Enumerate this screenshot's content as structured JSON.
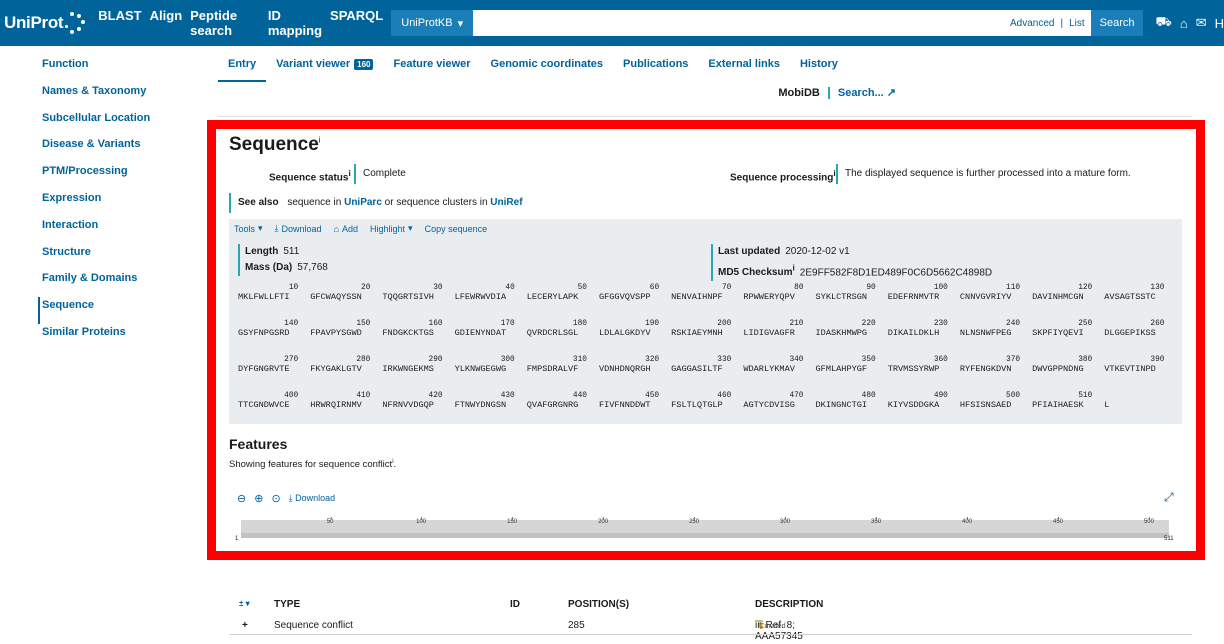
{
  "header": {
    "logo": "UniProt",
    "nav": [
      "BLAST",
      "Align",
      "Peptide search",
      "ID mapping",
      "SPARQL"
    ],
    "db_select": "UniProtKB",
    "search_placeholder": "",
    "advanced": "Advanced",
    "list": "List",
    "search_button": "Search",
    "truncated_label": "H"
  },
  "sidebar": {
    "items": [
      "Function",
      "Names & Taxonomy",
      "Subcellular Location",
      "Disease & Variants",
      "PTM/Processing",
      "Expression",
      "Interaction",
      "Structure",
      "Family & Domains",
      "Sequence",
      "Similar Proteins"
    ],
    "active": "Sequence"
  },
  "tabs": {
    "items": [
      "Entry",
      "Variant viewer",
      "Feature viewer",
      "Genomic coordinates",
      "Publications",
      "External links",
      "History"
    ],
    "variant_count": "160",
    "mobidb_label": "MobiDB",
    "mobidb_link": "Search..."
  },
  "sequence": {
    "title": "Sequence",
    "status_label": "Sequence status",
    "status_value": "Complete",
    "processing_label": "Sequence processing",
    "processing_value": "The displayed sequence is further processed into a mature form.",
    "see_also_label": "See also",
    "see_also_pre": "sequence in",
    "see_also_uniparc": "UniParc",
    "see_also_mid": "or sequence clusters in",
    "see_also_uniref": "UniRef",
    "toolbar": {
      "tools": "Tools",
      "download": "Download",
      "add": "Add",
      "highlight": "Highlight",
      "copy": "Copy sequence"
    },
    "length_label": "Length",
    "length_value": "511",
    "mass_label": "Mass (Da)",
    "mass_value": "57,768",
    "updated_label": "Last updated",
    "updated_value": "2020-12-02 v1",
    "md5_label": "MD5 Checksum",
    "md5_value": "2E9FF582F8D1ED489F0C6D5662C4898D",
    "rows": [
      [
        {
          "n": "10",
          "s": "MKLFWLLFTI"
        },
        {
          "n": "20",
          "s": "GFCWAQYSSN"
        },
        {
          "n": "30",
          "s": "TQQGRTSIVH"
        },
        {
          "n": "40",
          "s": "LFEWRWVDIA"
        },
        {
          "n": "50",
          "s": "LECERYLAPK"
        },
        {
          "n": "60",
          "s": "GFGGVQVSPP"
        },
        {
          "n": "70",
          "s": "NENVAIHNPF"
        },
        {
          "n": "80",
          "s": "RPWWERYQPV"
        },
        {
          "n": "90",
          "s": "SYKLCTRSGN"
        },
        {
          "n": "100",
          "s": "EDEFRNMVTR"
        },
        {
          "n": "110",
          "s": "CNNVGVRIYV"
        },
        {
          "n": "120",
          "s": "DAVINHMCGN"
        },
        {
          "n": "130",
          "s": "AVSAGTSSTC"
        }
      ],
      [
        {
          "n": "140",
          "s": "GSYFNPGSRD"
        },
        {
          "n": "150",
          "s": "FPAVPYSGWD"
        },
        {
          "n": "160",
          "s": "FNDGKCKTGS"
        },
        {
          "n": "170",
          "s": "GDIENYNDAT"
        },
        {
          "n": "180",
          "s": "QVRDCRLSGL"
        },
        {
          "n": "190",
          "s": "LDLALGKDYV"
        },
        {
          "n": "200",
          "s": "RSKIAEYMNH"
        },
        {
          "n": "210",
          "s": "LIDIGVAGFR"
        },
        {
          "n": "220",
          "s": "IDASKHMWPG"
        },
        {
          "n": "230",
          "s": "DIKAILDKLH"
        },
        {
          "n": "240",
          "s": "NLNSNWFPEG"
        },
        {
          "n": "250",
          "s": "SKPFIYQEVI"
        },
        {
          "n": "260",
          "s": "DLGGEPIKSS"
        }
      ],
      [
        {
          "n": "270",
          "s": "DYFGNGRVTE"
        },
        {
          "n": "280",
          "s": "FKYGAKLGTV"
        },
        {
          "n": "290",
          "s": "IRKWNGEKMS"
        },
        {
          "n": "300",
          "s": "YLKNWGEGWG"
        },
        {
          "n": "310",
          "s": "FMPSDRALVF"
        },
        {
          "n": "320",
          "s": "VDNHDNQRGH"
        },
        {
          "n": "330",
          "s": "GAGGASILTF"
        },
        {
          "n": "340",
          "s": "WDARLYKMAV"
        },
        {
          "n": "350",
          "s": "GFMLAHPYGF"
        },
        {
          "n": "360",
          "s": "TRVMSSYRWP"
        },
        {
          "n": "370",
          "s": "RYFENGKDVN"
        },
        {
          "n": "380",
          "s": "DWVGPPNDNG"
        },
        {
          "n": "390",
          "s": "VTKEVTINPD"
        }
      ],
      [
        {
          "n": "400",
          "s": "TTCGNDWVCE"
        },
        {
          "n": "410",
          "s": "HRWRQIRNMV"
        },
        {
          "n": "420",
          "s": "NFRNVVDGQP"
        },
        {
          "n": "430",
          "s": "FTNWYDNGSN"
        },
        {
          "n": "440",
          "s": "QVAFGRGNRG"
        },
        {
          "n": "450",
          "s": "FIVFNNDDWT"
        },
        {
          "n": "460",
          "s": "FSLTLQTGLP"
        },
        {
          "n": "470",
          "s": "AGTYCDVISG"
        },
        {
          "n": "480",
          "s": "DKINGNCTGI"
        },
        {
          "n": "490",
          "s": "KIYVSDDGKA"
        },
        {
          "n": "500",
          "s": "HFSISNSAED"
        },
        {
          "n": "510",
          "s": "PFIAIHAESK"
        },
        {
          "n": "",
          "s": "L"
        }
      ]
    ]
  },
  "features": {
    "title": "Features",
    "subtitle": "Showing features for sequence conflict",
    "download": "Download",
    "ruler_ticks": [
      "50",
      "100",
      "150",
      "200",
      "250",
      "300",
      "350",
      "400",
      "450",
      "500"
    ],
    "ruler_start": "1",
    "ruler_end": "511",
    "sequence_length": 511,
    "table_headers": {
      "toggle": "± ▾",
      "type": "TYPE",
      "id": "ID",
      "position": "POSITION(S)",
      "description": "DESCRIPTION"
    },
    "rows": [
      {
        "expand": "+",
        "type": "Sequence conflict",
        "id": "",
        "position": "285",
        "description": "in Ref. 8; AAA57345",
        "badge": "Curated"
      }
    ]
  },
  "colors": {
    "brand": "#00639a",
    "accent": "#2aa5b3",
    "highlight": "#ff0000"
  }
}
